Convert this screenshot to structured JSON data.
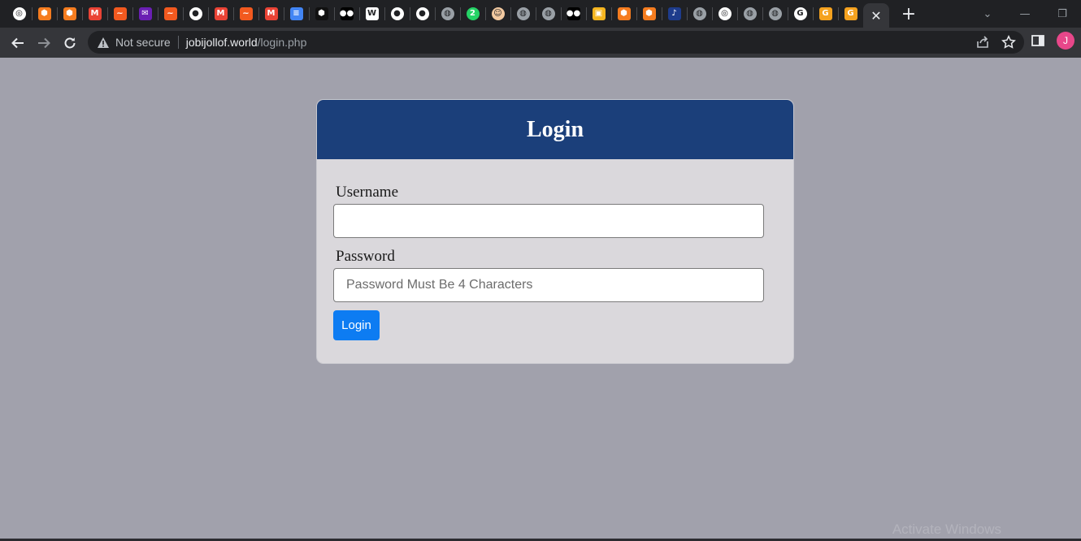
{
  "browser": {
    "tabs": [
      {
        "icon": "chrome-icon",
        "color": "#ffffff",
        "glyph": "◎"
      },
      {
        "icon": "orange-cube-icon",
        "color": "#f57c1f",
        "glyph": "⬢"
      },
      {
        "icon": "orange-cube-icon",
        "color": "#f57c1f",
        "glyph": "⬢"
      },
      {
        "icon": "gmail-icon",
        "color": "#ea4335",
        "glyph": "M"
      },
      {
        "icon": "orange-wave-icon",
        "color": "#f2591f",
        "glyph": "~"
      },
      {
        "icon": "purple-mail-icon",
        "color": "#6a1fb3",
        "glyph": "✉"
      },
      {
        "icon": "orange-wave-icon",
        "color": "#f2591f",
        "glyph": "~"
      },
      {
        "icon": "github-icon",
        "color": "#ffffff",
        "glyph": "●"
      },
      {
        "icon": "gmail-icon",
        "color": "#ea4335",
        "glyph": "M"
      },
      {
        "icon": "orange-wave-icon",
        "color": "#f2591f",
        "glyph": "~"
      },
      {
        "icon": "gmail-icon",
        "color": "#ea4335",
        "glyph": "M"
      },
      {
        "icon": "google-docs-icon",
        "color": "#4285f4",
        "glyph": "≡"
      },
      {
        "icon": "hexagon-icon",
        "color": "#111111",
        "glyph": "⬢"
      },
      {
        "icon": "medium-icon",
        "color": "#000000",
        "glyph": "●●"
      },
      {
        "icon": "wikipedia-icon",
        "color": "#ffffff",
        "glyph": "W"
      },
      {
        "icon": "github-icon",
        "color": "#ffffff",
        "glyph": "●"
      },
      {
        "icon": "github-icon",
        "color": "#ffffff",
        "glyph": "●"
      },
      {
        "icon": "globe-icon",
        "color": "#9aa0a6",
        "glyph": "◍"
      },
      {
        "icon": "whatsapp-icon",
        "color": "#25d366",
        "glyph": "2"
      },
      {
        "icon": "avatar-face-icon",
        "color": "#f2c9a0",
        "glyph": "☺"
      },
      {
        "icon": "globe-icon",
        "color": "#9aa0a6",
        "glyph": "◍"
      },
      {
        "icon": "globe-icon",
        "color": "#9aa0a6",
        "glyph": "◍"
      },
      {
        "icon": "medium-icon",
        "color": "#000000",
        "glyph": "●●"
      },
      {
        "icon": "yellow-box-icon",
        "color": "#f5b51f",
        "glyph": "▣"
      },
      {
        "icon": "orange-cube-icon",
        "color": "#f57c1f",
        "glyph": "⬢"
      },
      {
        "icon": "orange-cube-icon",
        "color": "#f57c1f",
        "glyph": "⬢"
      },
      {
        "icon": "blue-app-icon",
        "color": "#1e3c8c",
        "glyph": "♪"
      },
      {
        "icon": "globe-icon",
        "color": "#9aa0a6",
        "glyph": "◍"
      },
      {
        "icon": "chrome-icon",
        "color": "#ffffff",
        "glyph": "◎"
      },
      {
        "icon": "globe-icon",
        "color": "#9aa0a6",
        "glyph": "◍"
      },
      {
        "icon": "globe-icon",
        "color": "#9aa0a6",
        "glyph": "◍"
      },
      {
        "icon": "google-icon",
        "color": "#ffffff",
        "glyph": "G"
      },
      {
        "icon": "g-orange-icon",
        "color": "#f5a21f",
        "glyph": "G"
      },
      {
        "icon": "g-orange-icon",
        "color": "#f5a21f",
        "glyph": "G"
      }
    ],
    "active_tab_close": "✕",
    "new_tab_glyph": "+",
    "window_controls": {
      "tab_search": "⌄",
      "minimize": "—",
      "restore": "❐"
    },
    "security_label": "Not secure",
    "url_host": "jobijollof.world",
    "url_path": "/login.php",
    "profile_initial": "J"
  },
  "page": {
    "title": "Login",
    "username_label": "Username",
    "username_value": "",
    "password_label": "Password",
    "password_placeholder": "Password Must Be 4 Characters",
    "submit_label": "Login",
    "watermark": "Activate Windows"
  },
  "colors": {
    "page_background": "#a1a1ac",
    "card_header": "#1b3f7a",
    "card_body": "#dad8dc",
    "button": "#0d7cf2"
  }
}
